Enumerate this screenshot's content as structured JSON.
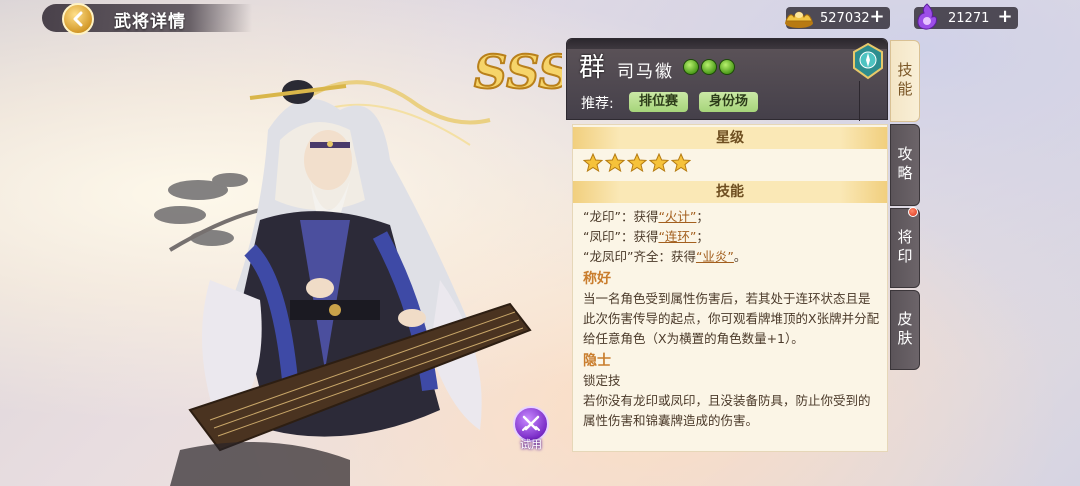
{
  "header": {
    "title": "武将详情"
  },
  "currencies": {
    "gold": {
      "value": "527032",
      "icon": "gold-ingot-icon",
      "plus": "+"
    },
    "gem": {
      "value": "21271",
      "icon": "purple-flame-icon",
      "plus": "+"
    }
  },
  "character": {
    "grade": "SSS",
    "faction": "群",
    "name": "司马徽",
    "hp": 3,
    "recommend_label": "推荐:",
    "recommend_tags": [
      "排位赛",
      "身份场"
    ]
  },
  "try_button": {
    "label": "试用"
  },
  "panel": {
    "star_header": "星级",
    "stars": 5,
    "skill_header": "技能",
    "skill_lines": [
      {
        "pre": "“龙印”：获得",
        "link": "“火计”",
        "post": "；"
      },
      {
        "pre": "“凤印”：获得",
        "link": "“连环”",
        "post": "；"
      },
      {
        "pre": "“龙凤印”齐全：获得",
        "link": "“业炎”",
        "post": "。"
      }
    ],
    "skills": [
      {
        "name": "称好",
        "desc": "当一名角色受到属性伤害后，若其处于连环状态且是此次伤害传导的起点，你可观看牌堆顶的X张牌并分配给任意角色（X为横置的角色数量+1）。"
      },
      {
        "name": "隐士",
        "tag": "锁定技",
        "desc": "若你没有龙印或凤印，且没装备防具，防止你受到的属性伤害和锦囊牌造成的伤害。"
      }
    ]
  },
  "side_tabs": [
    "技能",
    "攻略",
    "将印",
    "皮肤"
  ],
  "colors": {
    "accent_gold": "#f1cf7e",
    "panel_bg": "#fbf5e6",
    "tag_green": "#a6d57a",
    "skill_title": "#c97d2d"
  }
}
